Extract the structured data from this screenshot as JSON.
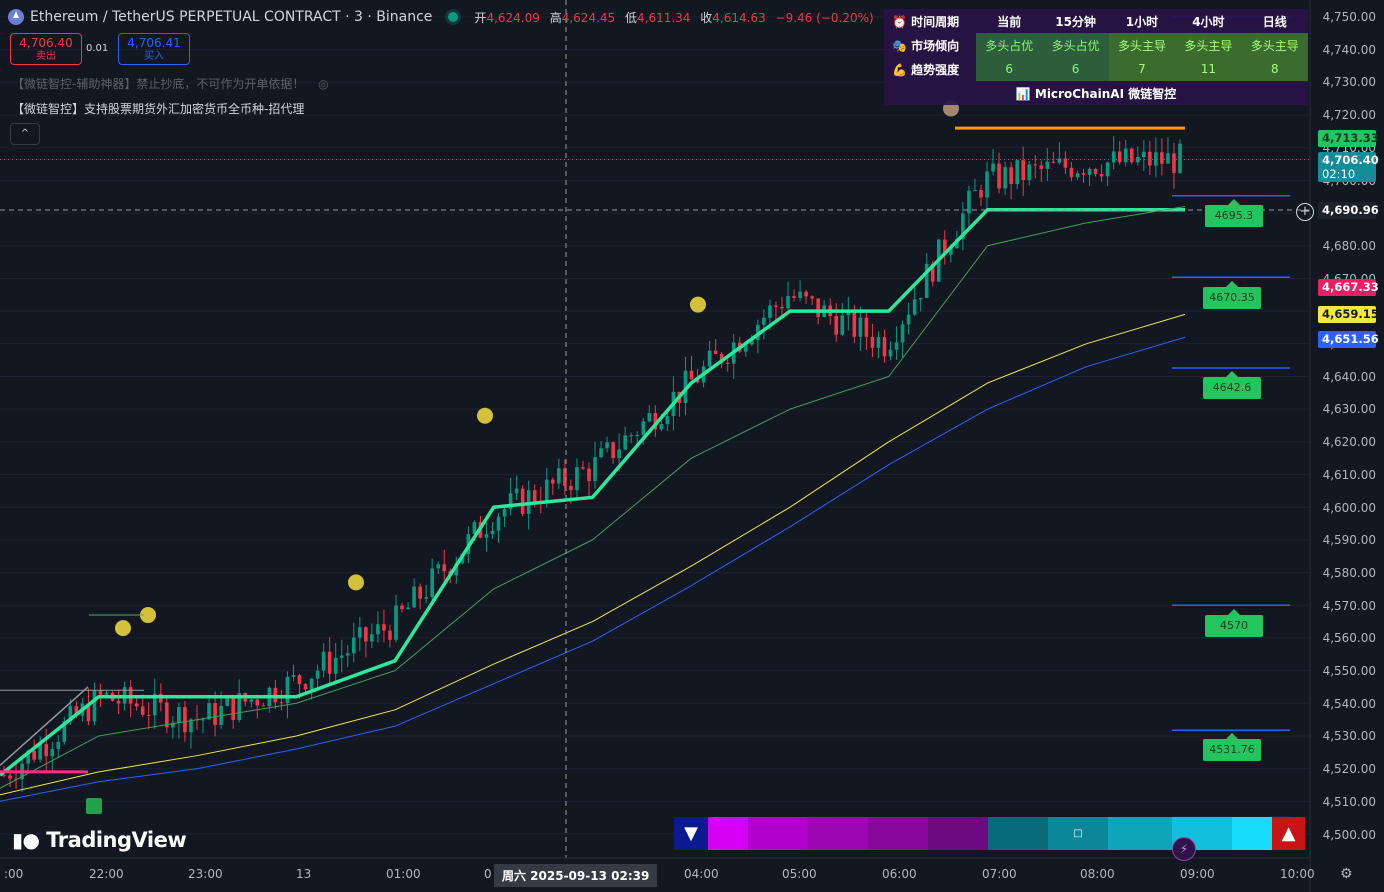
{
  "header": {
    "symbol_title": "Ethereum / TetherUS PERPETUAL CONTRACT · 3 · Binance",
    "ohlc": [
      {
        "k": "开",
        "v": "4,624.09"
      },
      {
        "k": "高",
        "v": "4,624.45"
      },
      {
        "k": "低",
        "v": "4,611.34"
      },
      {
        "k": "收",
        "v": "4,614.63"
      }
    ],
    "change": "−9.46 (−0.20%)"
  },
  "trade": {
    "sell_price": "4,706.40",
    "sell_label": "卖出",
    "spread": "0.01",
    "buy_price": "4,706.41",
    "buy_label": "买入"
  },
  "indicators": {
    "line1": "【微链智控-辅助神器】禁止抄底，不可作为开单依据！",
    "line2": "【微链智控】支持股票期货外汇加密货币全币种-招代理",
    "collapse_glyph": "^"
  },
  "table": {
    "headers": [
      "时间周期",
      "当前",
      "15分钟",
      "1小时",
      "4小时",
      "日线"
    ],
    "trend_label": "市场倾向",
    "trend": [
      "多头占优",
      "多头占优",
      "多头主导",
      "多头主导",
      "多头主导"
    ],
    "strength_label": "趋势强度",
    "strength": [
      "6",
      "6",
      "7",
      "11",
      "8"
    ],
    "footer": "MicroChainAI 微链智控",
    "colors": {
      "bg": "#281446",
      "green_text": "#7bff6a"
    }
  },
  "price_axis": {
    "labels": [
      "4,750.00",
      "4,740.00",
      "4,730.00",
      "4,720.00",
      "4,710.00",
      "4,700.00",
      "4,690.00",
      "4,680.00",
      "4,670.00",
      "4,660.00",
      "4,650.00",
      "4,640.00",
      "4,630.00",
      "4,620.00",
      "4,610.00",
      "4,600.00",
      "4,590.00",
      "4,580.00",
      "4,570.00",
      "4,560.00",
      "4,550.00",
      "4,540.00",
      "4,530.00",
      "4,520.00",
      "4,510.00",
      "4,500.00"
    ]
  },
  "price_tags": [
    {
      "text": "4,713.33",
      "bg": "#22c55e",
      "fg": "#0b3d1e"
    },
    {
      "text": "4,706.40",
      "bg": "#138d99",
      "fg": "#ffffff",
      "sub": "02:10"
    },
    {
      "text": "4,690.96",
      "bg": "#1e222d",
      "fg": "#ffffff"
    },
    {
      "text": "4,667.33",
      "bg": "#e91e63",
      "fg": "#ffffff"
    },
    {
      "text": "4,659.15",
      "bg": "#f5e642",
      "fg": "#1b1b1b"
    },
    {
      "text": "4,651.56",
      "bg": "#2962ff",
      "fg": "#ffffff"
    }
  ],
  "signal_levels": [
    {
      "text": "4695.3"
    },
    {
      "text": "4670.35"
    },
    {
      "text": "4642.6"
    },
    {
      "text": "4570"
    },
    {
      "text": "4531.76"
    }
  ],
  "time_axis": {
    "labels": [
      ":00",
      "22:00",
      "23:00",
      "13",
      "01:00",
      "0",
      "04:00",
      "05:00",
      "06:00",
      "07:00",
      "08:00",
      "09:00",
      "10:00"
    ],
    "crosshair_date": "周六 2025-09-13   02:39"
  },
  "logo": "TradingView",
  "chart_data": {
    "type": "candlestick",
    "title": "Ethereum / TetherUS PERPETUAL CONTRACT · 3 · Binance",
    "ylim": [
      4500,
      4750
    ],
    "x": [
      "21:00",
      "22:00",
      "23:00",
      "00:00",
      "01:00",
      "02:00",
      "03:00",
      "04:00",
      "05:00",
      "06:00",
      "07:00",
      "08:00",
      "09:00"
    ],
    "close_approx": [
      4518,
      4542,
      4535,
      4547,
      4565,
      4598,
      4612,
      4638,
      4665,
      4650,
      4700,
      4705,
      4706.4
    ],
    "series": [
      {
        "name": "trailing-stop",
        "color": "#2ee89a",
        "values": [
          4518,
          4542,
          4542,
          4542,
          4553,
          4600,
          4603,
          4638,
          4660,
          4660,
          4691,
          4691,
          4691
        ]
      },
      {
        "name": "ma-green",
        "color": "#3fa34d",
        "values": [
          4514,
          4530,
          4535,
          4540,
          4550,
          4575,
          4590,
          4615,
          4630,
          4640,
          4680,
          4687,
          4692
        ]
      },
      {
        "name": "ma-yellow",
        "color": "#f5e642",
        "values": [
          4512,
          4519,
          4524,
          4530,
          4538,
          4552,
          4565,
          4582,
          4600,
          4620,
          4638,
          4650,
          4659
        ]
      },
      {
        "name": "ma-blue",
        "color": "#2962ff",
        "values": [
          4510,
          4516,
          4520,
          4526,
          4533,
          4546,
          4559,
          4576,
          4594,
          4613,
          4630,
          4643,
          4652
        ]
      }
    ]
  }
}
